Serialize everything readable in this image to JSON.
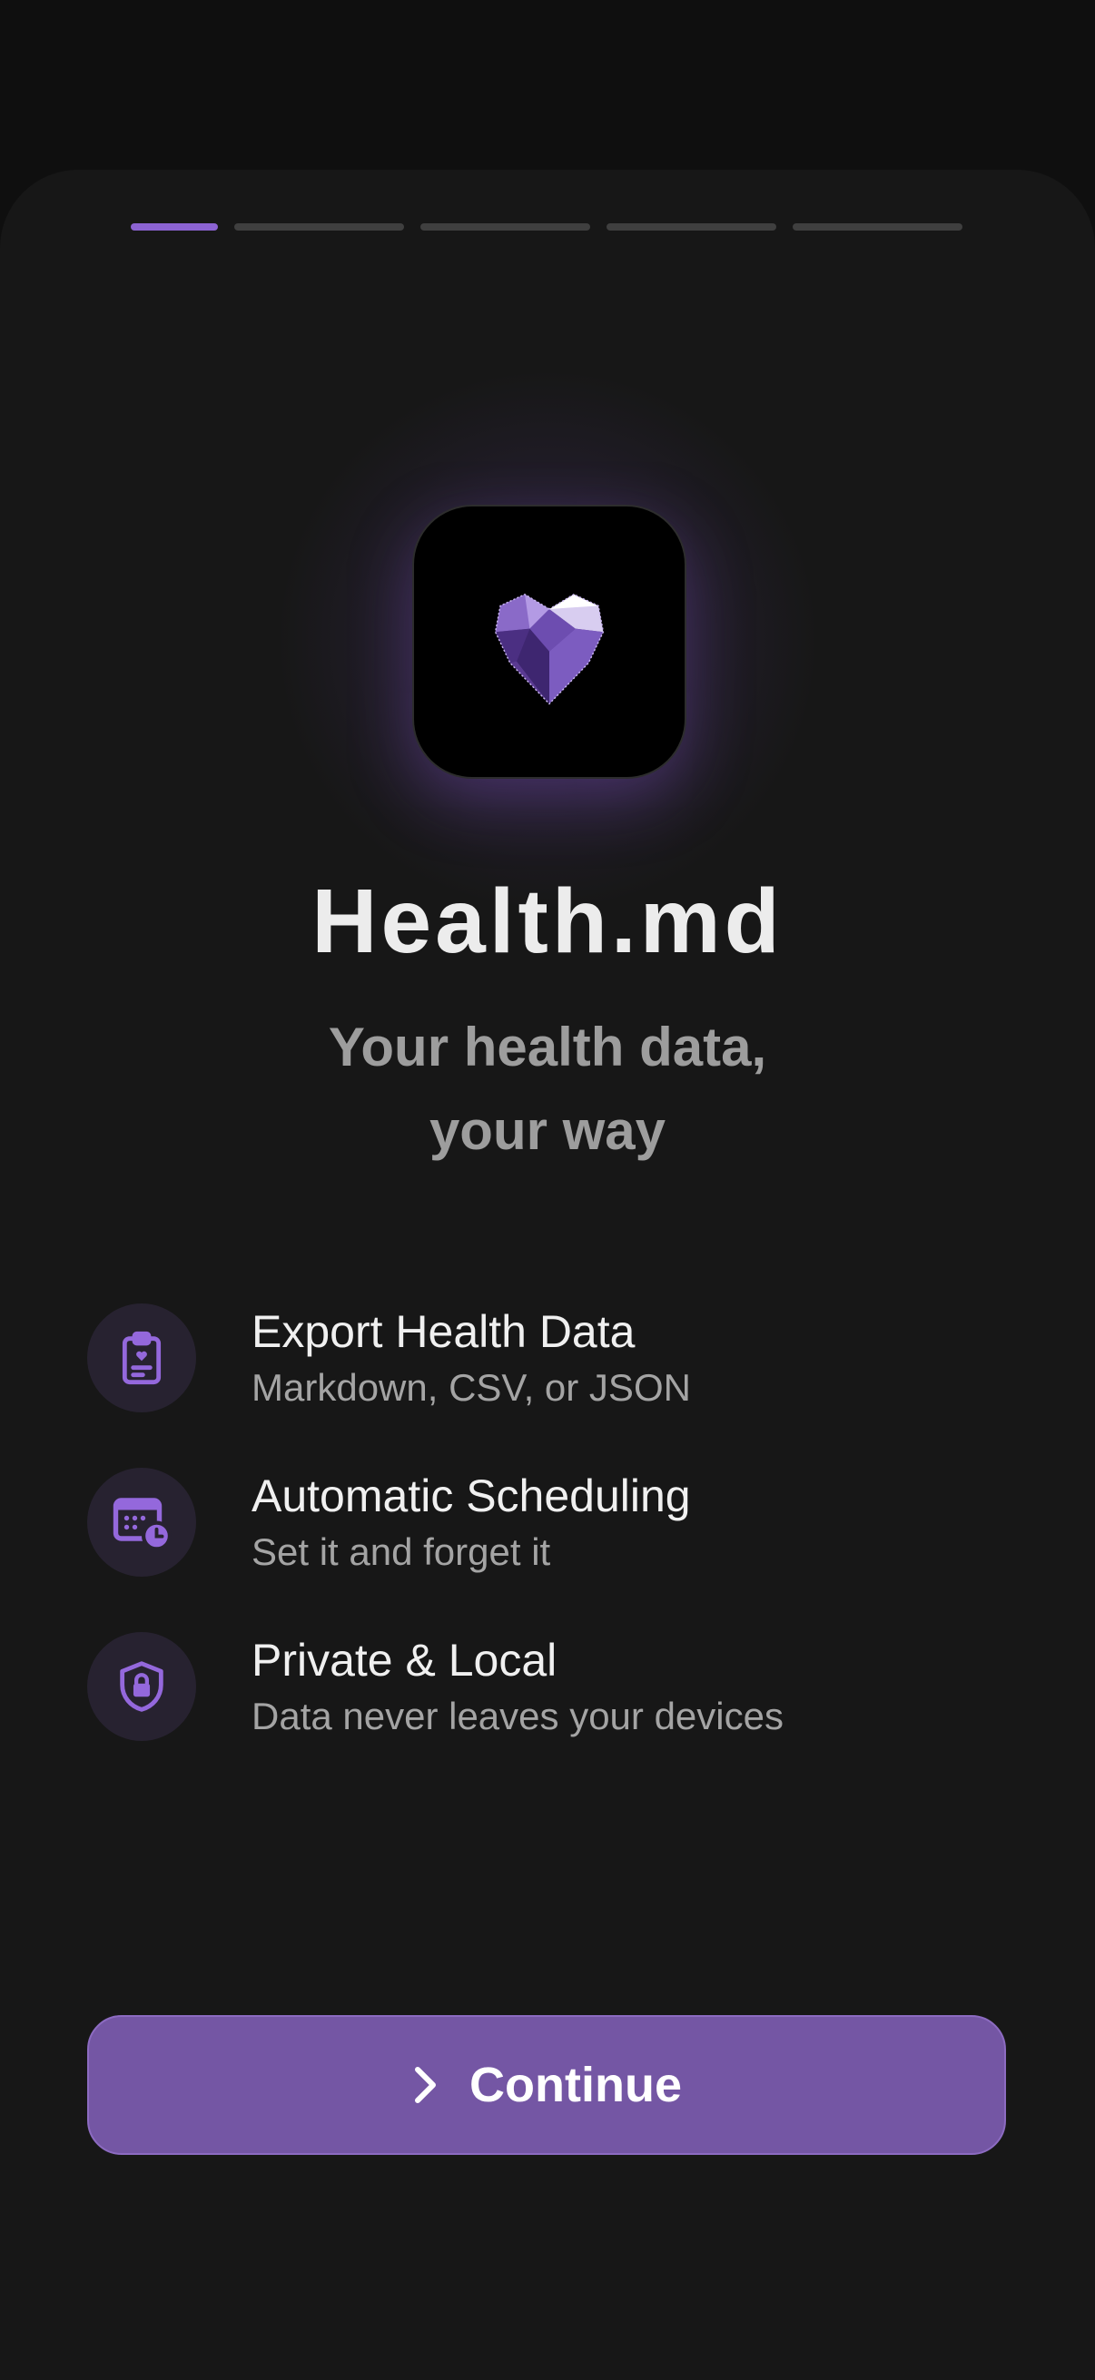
{
  "onboarding": {
    "total_steps": 5,
    "current_step": 1
  },
  "app": {
    "name": "Health.md",
    "tagline_line1": "Your health data,",
    "tagline_line2": "your way",
    "icon": "crystal-heart-icon"
  },
  "features": [
    {
      "icon": "clipboard-heart-icon",
      "title": "Export Health Data",
      "subtitle": "Markdown, CSV, or JSON"
    },
    {
      "icon": "calendar-clock-icon",
      "title": "Automatic Scheduling",
      "subtitle": "Set it and forget it"
    },
    {
      "icon": "shield-lock-icon",
      "title": "Private & Local",
      "subtitle": "Data never leaves your devices"
    }
  ],
  "cta": {
    "label": "Continue",
    "icon": "chevron-right-icon"
  },
  "colors": {
    "background": "#171717",
    "accent": "#8c63d2",
    "button": "#7456a4"
  }
}
